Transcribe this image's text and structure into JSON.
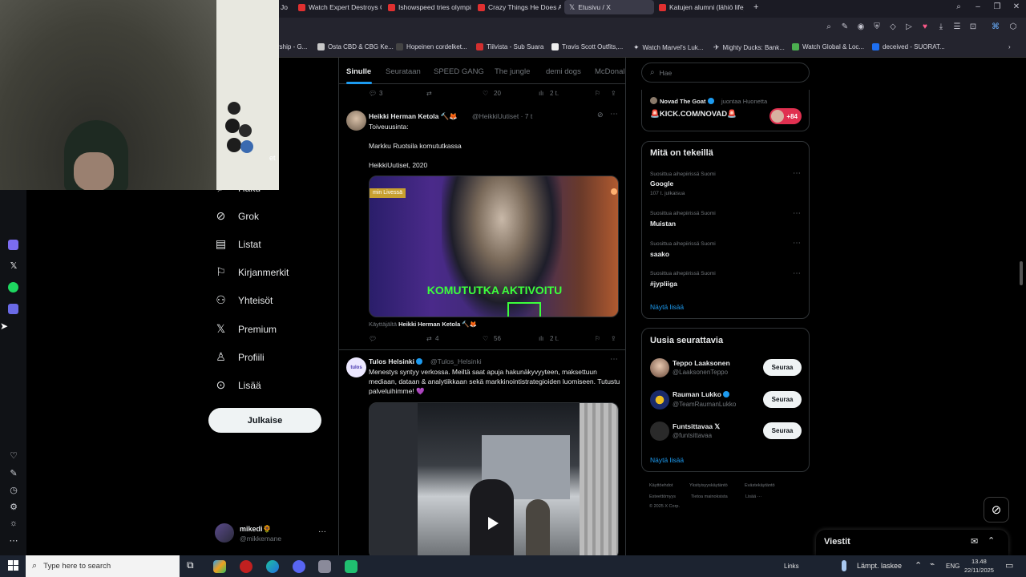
{
  "browser": {
    "tabs": [
      {
        "label": "Jo",
        "active": false
      },
      {
        "label": "Watch Expert Destroys C",
        "active": false
      },
      {
        "label": "Ishowspeed tries olympic",
        "active": false
      },
      {
        "label": "Crazy Things He Does Afte",
        "active": false
      },
      {
        "label": "Etusivu / X",
        "active": true
      },
      {
        "label": "Katujen alumni (lähiö life)",
        "active": false
      }
    ],
    "new_tab": "+",
    "bookmarks": [
      "rship - G...",
      "Osta CBD & CBG Ke...",
      "Hopeinen cordelket...",
      "Tiilvista - Sub Suara",
      "Travis Scott Outfits,...",
      "Watch Marvel's Luk...",
      "Mighty Ducks: Bank...",
      "Watch Global & Loc...",
      "deceived - SUORAT..."
    ]
  },
  "dock": {
    "colors": {
      "app1": "#7b6cf0",
      "app2": "#111111",
      "spotify": "#1ed760",
      "app4": "#6a6ae6"
    }
  },
  "nav": {
    "partial_top_label": "et",
    "partial_item": "Haku",
    "items": [
      {
        "label": "Grok",
        "icon": "grok-icon"
      },
      {
        "label": "Listat",
        "icon": "list-icon"
      },
      {
        "label": "Kirjanmerkit",
        "icon": "bookmark-icon"
      },
      {
        "label": "Yhteisöt",
        "icon": "communities-icon"
      },
      {
        "label": "Premium",
        "icon": "x-logo-icon"
      },
      {
        "label": "Profiili",
        "icon": "profile-icon"
      },
      {
        "label": "Lisää",
        "icon": "more-circle-icon"
      }
    ],
    "post_button": "Julkaise",
    "account": {
      "name": "mikedi🌻",
      "handle": "@mikkemane",
      "more": "···"
    }
  },
  "feed": {
    "tabs": [
      "Sinulle",
      "Seurataan",
      "SPEED GANG",
      "The jungle",
      "demi dogs",
      "McDonal"
    ],
    "top_actions": {
      "replies": "3",
      "retweets": "",
      "likes": "20",
      "views": "2 t."
    },
    "tweet1": {
      "name": "Heikki Herman Ketola 🔨🦊",
      "handle": "@HeikkiUutiset · 7 t",
      "line1": "Toiveuusinta:",
      "line2": "Markku Ruotsila komututkassa",
      "line3": "HeikkiUutiset, 2020",
      "media_badge": "min Livessä",
      "media_caption": "KOMUTUTKA AKTIVOITU",
      "used_by_prefix": "Käyttäjältä",
      "used_by_name": "Heikki Herman Ketola 🔨🦊",
      "replies": "",
      "retweets": "4",
      "likes": "56",
      "views": "2 t."
    },
    "tweet2": {
      "name": "Tulos Helsinki",
      "handle": "@Tulos_Helsinki",
      "avatar_text": "tulos",
      "text": "Menestys syntyy verkossa. Meiltä saat apuja hakunäkyvyyteen, maksettuun mediaan, dataan & analytiikkaan sekä markkinointistrategioiden luomiseen. Tutustu palveluihimme! 💜"
    }
  },
  "right": {
    "search_placeholder": "Hae",
    "live": {
      "name": "Novad The Goat",
      "suffix": "juontaa Huonetta",
      "title": "🚨KICK.COM/NOVAD🚨",
      "count": "+84"
    },
    "trends_title": "Mitä on tekeillä",
    "trends": [
      {
        "context": "Suosittua aihepiirissä Suomi",
        "name": "Google",
        "meta": "107 t. julkaisua"
      },
      {
        "context": "Suosittua aihepiirissä Suomi",
        "name": "Muistan",
        "meta": ""
      },
      {
        "context": "Suosittua aihepiirissä Suomi",
        "name": "saako",
        "meta": ""
      },
      {
        "context": "Suosittua aihepiirissä Suomi",
        "name": "#jypliiga",
        "meta": ""
      }
    ],
    "trends_more": "Näytä lisää",
    "follow_title": "Uusia seurattavia",
    "follow": [
      {
        "name": "Teppo Laaksonen",
        "handle": "@LaaksonenTeppo",
        "button": "Seuraa"
      },
      {
        "name": "Rauman Lukko",
        "handle": "@TeamRaumanLukko",
        "button": "Seuraa"
      },
      {
        "name": "Funtsittavaa 𝕏",
        "handle": "@funtsittavaa",
        "button": "Seuraa"
      }
    ],
    "follow_more": "Näytä lisää",
    "footer": {
      "l1": [
        "Käyttöehdot",
        "Yksityisyyskäytäntö",
        "Evästekäytäntö"
      ],
      "l2": [
        "Esteettömyys",
        "Tietoa mainoksista",
        "Lisää ···"
      ],
      "l3": "© 2025 X Corp."
    },
    "messages": "Viestit"
  },
  "taskbar": {
    "search_placeholder": "Type here to search",
    "links": "Links",
    "weather": "Lämpt. laskee",
    "lang": "ENG",
    "time": "13.48",
    "date": "22/11/2025"
  }
}
